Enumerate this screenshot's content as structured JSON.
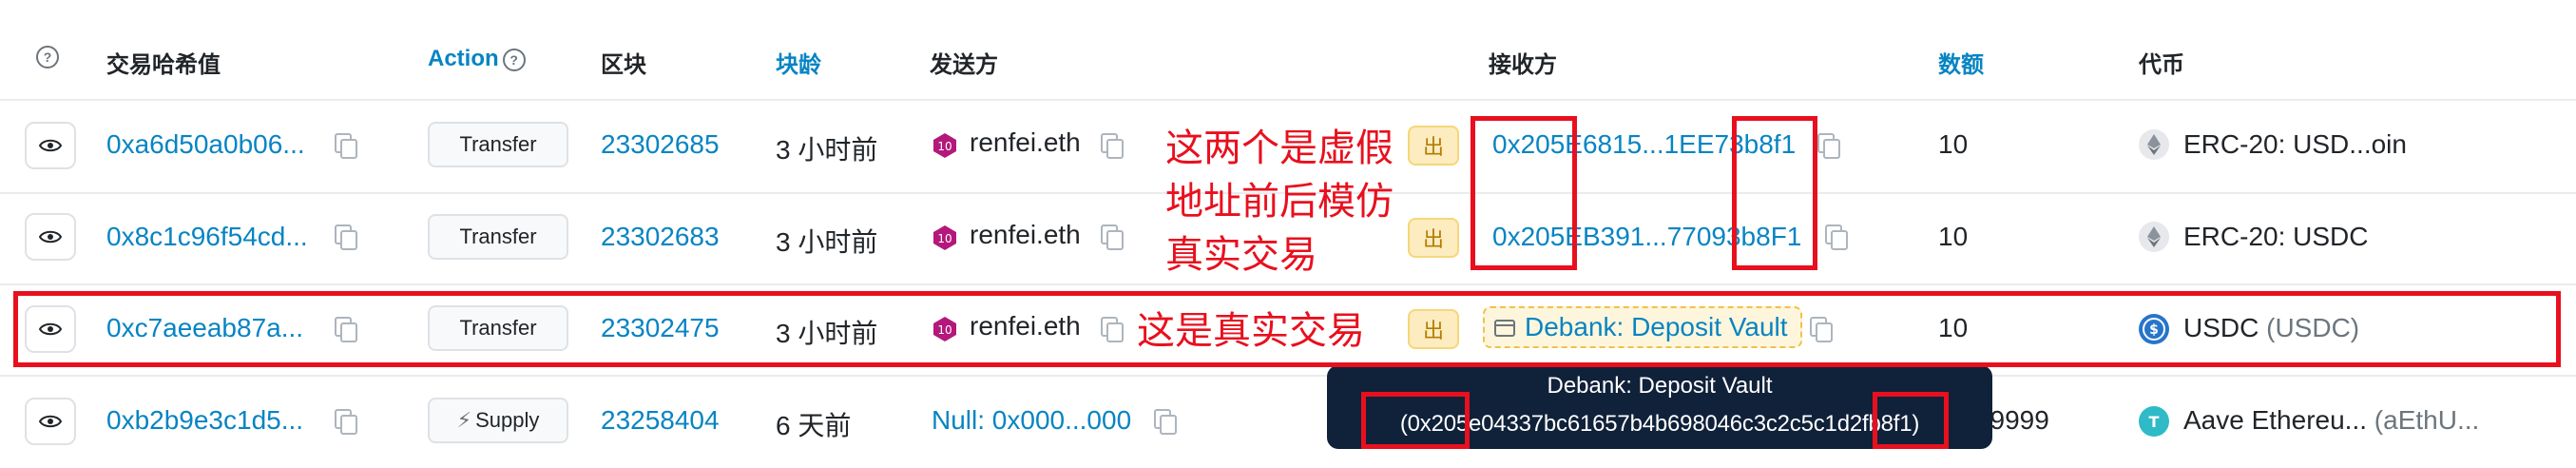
{
  "headers": {
    "txhash": "交易哈希值",
    "action": "Action",
    "block": "区块",
    "age": "块龄",
    "from": "发送方",
    "to": "接收方",
    "amount": "数额",
    "token": "代币"
  },
  "rows": [
    {
      "hash": "0xa6d50a0b06...",
      "action": "Transfer",
      "block": "23302685",
      "age": "3 小时前",
      "from": "renfei.eth",
      "direction": "出",
      "to": "0x205E6815...1EE73b8f1",
      "amount": "10",
      "token": "ERC-20: USD...oin",
      "token_suffix": ""
    },
    {
      "hash": "0x8c1c96f54cd...",
      "action": "Transfer",
      "block": "23302683",
      "age": "3 小时前",
      "from": "renfei.eth",
      "direction": "出",
      "to": "0x205EB391...77093b8F1",
      "amount": "10",
      "token": "ERC-20: USDC",
      "token_suffix": ""
    },
    {
      "hash": "0xc7aeeab87a...",
      "action": "Transfer",
      "block": "23302475",
      "age": "3 小时前",
      "from": "renfei.eth",
      "direction": "出",
      "to": "Debank: Deposit Vault",
      "amount": "10",
      "token": "USDC",
      "token_suffix": "(USDC)"
    },
    {
      "hash": "0xb2b9e3c1d5...",
      "action": "Supply",
      "block": "23258404",
      "age": "6 天前",
      "from": "Null: 0x000...000",
      "direction": "",
      "to": "",
      "amount": "3.999999",
      "token": "Aave Ethereu...",
      "token_suffix": "(aEthU..."
    }
  ],
  "tooltip": {
    "title": "Debank: Deposit Vault",
    "address": "(0x205e04337bc61657b4b698046c3c2c5c1d2fb8f1)"
  },
  "annotations": {
    "fake_lines": [
      "这两个是虚假",
      "地址前后模仿",
      "真实交易"
    ],
    "real": "这是真实交易"
  },
  "colors": {
    "link": "#0784c3",
    "annotation": "#e8101e",
    "badge_bg": "#fcecc0",
    "tooltip_bg": "#10213a"
  }
}
